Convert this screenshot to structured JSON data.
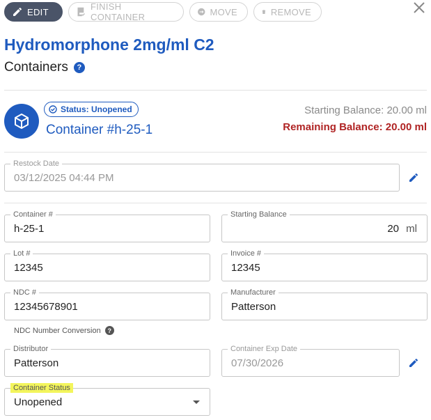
{
  "toolbar": {
    "edit_label": "EDIT",
    "finish_label": "FINISH CONTAINER",
    "move_label": "MOVE",
    "remove_label": "REMOVE"
  },
  "header": {
    "title": "Hydromorphone 2mg/ml C2",
    "subtitle": "Containers",
    "help_glyph": "?"
  },
  "container": {
    "status": "Status: Unopened",
    "name": "Container #h-25-1",
    "starting_balance": "Starting Balance: 20.00 ml",
    "remaining_balance": "Remaining Balance: 20.00 ml"
  },
  "fields": {
    "restock_date": {
      "label": "Restock Date",
      "value": "03/12/2025 04:44 PM"
    },
    "container_no": {
      "label": "Container #",
      "value": "h-25-1"
    },
    "starting_balance": {
      "label": "Starting Balance",
      "value": "20",
      "unit": "ml"
    },
    "lot_no": {
      "label": "Lot #",
      "value": "12345"
    },
    "invoice_no": {
      "label": "Invoice #",
      "value": "12345"
    },
    "ndc_no": {
      "label": "NDC #",
      "value": "12345678901"
    },
    "manufacturer": {
      "label": "Manufacturer",
      "value": "Patterson"
    },
    "ndc_conversion": {
      "label": "NDC Number Conversion",
      "help_glyph": "?"
    },
    "distributor": {
      "label": "Distributor",
      "value": "Patterson"
    },
    "exp_date": {
      "label": "Container Exp Date",
      "value": "07/30/2026"
    },
    "container_status": {
      "label": "Container Status",
      "value": "Unopened"
    }
  },
  "colors": {
    "accent": "#1f5bbf",
    "danger": "#b02424",
    "highlight": "#f3f55c",
    "edit_button": "#4a5468"
  },
  "icons": {
    "edit": "pencil-icon",
    "finish": "checklist-icon",
    "move": "move-arrow-icon",
    "remove": "trash-icon",
    "close": "close-icon",
    "container": "cube-icon",
    "status": "check-circle-icon",
    "help": "help-icon",
    "dropdown": "caret-down-icon"
  }
}
